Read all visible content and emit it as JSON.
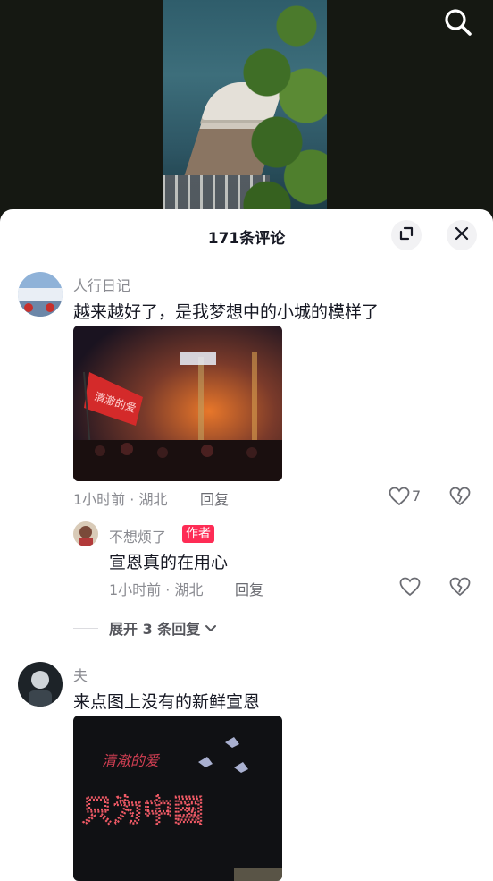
{
  "header": {
    "title": "171条评论"
  },
  "comments": [
    {
      "user": "人行日记",
      "text": "越来越好了，是我梦想中的小城的模样了",
      "time_location": "1小时前 · 湖北",
      "reply_label": "回复",
      "likes": "7",
      "image_text": "清澈的爱 只为中国"
    },
    {
      "user": "夫",
      "text": "来点图上没有的新鲜宣恩",
      "image_text": "清澈的爱 只为中国"
    }
  ],
  "reply": {
    "user": "不想烦了",
    "badge": "作者",
    "text": "宣恩真的在用心",
    "time_location": "1小时前 · 湖北",
    "reply_label": "回复"
  },
  "expand_replies": {
    "label": "展开 3 条回复"
  },
  "colors": {
    "accent": "#fe2c55",
    "sheet": "#ffffff",
    "muted": "#8a8b91"
  }
}
